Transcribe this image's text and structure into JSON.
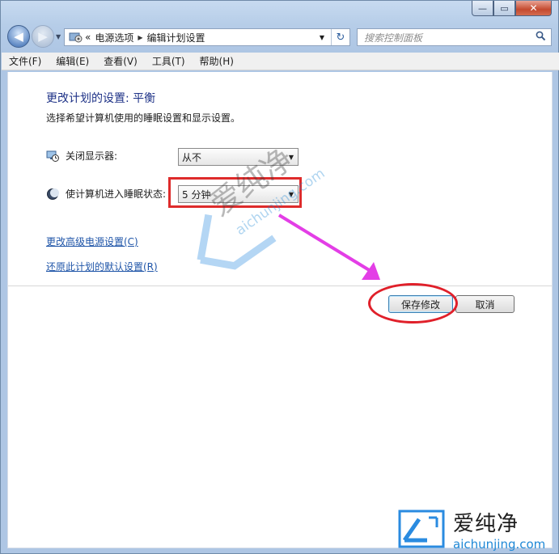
{
  "window": {
    "min_glyph": "—",
    "max_glyph": "▭",
    "close_glyph": "✕"
  },
  "nav": {
    "back_glyph": "◀",
    "forward_glyph": "▶",
    "dropdown_glyph": "▼",
    "address": {
      "overflow": "«",
      "crumbs": [
        "电源选项",
        "编辑计划设置"
      ],
      "separator_glyph": "▶",
      "dropdown_glyph": "▼",
      "refresh_glyph": "↻"
    },
    "search": {
      "placeholder": "搜索控制面板",
      "icon": "search-icon"
    }
  },
  "menu": [
    "文件(F)",
    "编辑(E)",
    "查看(V)",
    "工具(T)",
    "帮助(H)"
  ],
  "page": {
    "title": "更改计划的设置: 平衡",
    "subtitle": "选择希望计算机使用的睡眠设置和显示设置。",
    "display_off": {
      "label": "关闭显示器:",
      "value": "从不",
      "icon": "monitor-clock-icon"
    },
    "sleep": {
      "label": "使计算机进入睡眠状态:",
      "value": "5 分钟",
      "icon": "moon-icon"
    },
    "links": {
      "advanced": "更改高级电源设置(C)",
      "restore": "还原此计划的默认设置(R)"
    },
    "buttons": {
      "save": "保存修改",
      "cancel": "取消"
    }
  },
  "watermark": {
    "cn": "爱纯净",
    "en": "aichunjing.com"
  },
  "colors": {
    "annotation_red": "#de2b2b",
    "arrow_magenta": "#e33ee6",
    "link_blue": "#1f55a8",
    "title_blue": "#1e3287"
  }
}
